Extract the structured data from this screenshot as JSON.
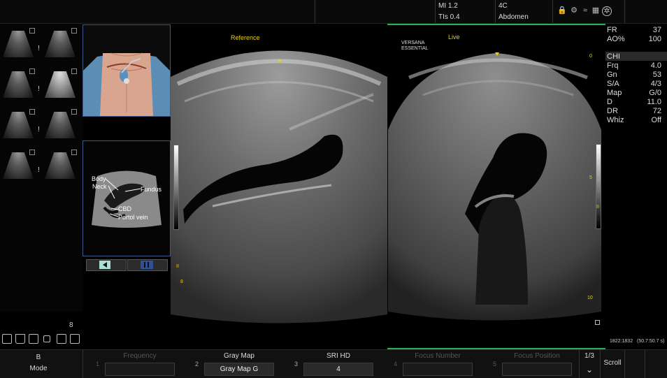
{
  "header": {
    "mi": "MI 1.2",
    "tis": "TIs 0.4",
    "probe": "4C",
    "preset": "Abdomen"
  },
  "icons": [
    "lock-icon",
    "probe-icon",
    "wifi-icon",
    "network-icon",
    "settings-icon"
  ],
  "thumb_badges": [
    "!",
    "!",
    "!",
    "!"
  ],
  "diagram": {
    "labels": [
      "Body",
      "Neck",
      "Fundus",
      "CBD",
      "Portol vein"
    ]
  },
  "images": {
    "reference_label": "Reference",
    "live_label": "Live",
    "live_brand_1": "VERSANA",
    "live_brand_2": "ESSENTIAL",
    "live_depth_top": "0",
    "live_depth_mid": "5",
    "live_depth_bot": "10",
    "ref_depth_mid": "8"
  },
  "params": [
    {
      "label": "FR",
      "value": "37"
    },
    {
      "label": "AO%",
      "value": "100"
    },
    {
      "label": "CHI",
      "value": ""
    },
    {
      "label": "Frq",
      "value": "4.0"
    },
    {
      "label": "Gn",
      "value": "53"
    },
    {
      "label": "S/A",
      "value": "4/3"
    },
    {
      "label": "Map",
      "value": "G/0"
    },
    {
      "label": "D",
      "value": "11.0"
    },
    {
      "label": "DR",
      "value": "72"
    },
    {
      "label": "Whiz",
      "value": "Off"
    }
  ],
  "frame_counter": "1822:1832",
  "frame_range": "(50.7:50.7 s)",
  "toolbar_count": "8",
  "bottom": {
    "mode_top": "B",
    "mode_label": "Mode",
    "knobs": [
      {
        "num": "1",
        "label": "Frequency",
        "value": "",
        "active": false
      },
      {
        "num": "2",
        "label": "Gray Map",
        "value": "Gray Map G",
        "active": true
      },
      {
        "num": "3",
        "label": "SRI HD",
        "value": "4",
        "active": true
      },
      {
        "num": "4",
        "label": "Focus Number",
        "value": "",
        "active": false
      },
      {
        "num": "5",
        "label": "Focus Position",
        "value": "",
        "active": false
      }
    ],
    "page": "1/3",
    "scroll": "Scroll"
  }
}
